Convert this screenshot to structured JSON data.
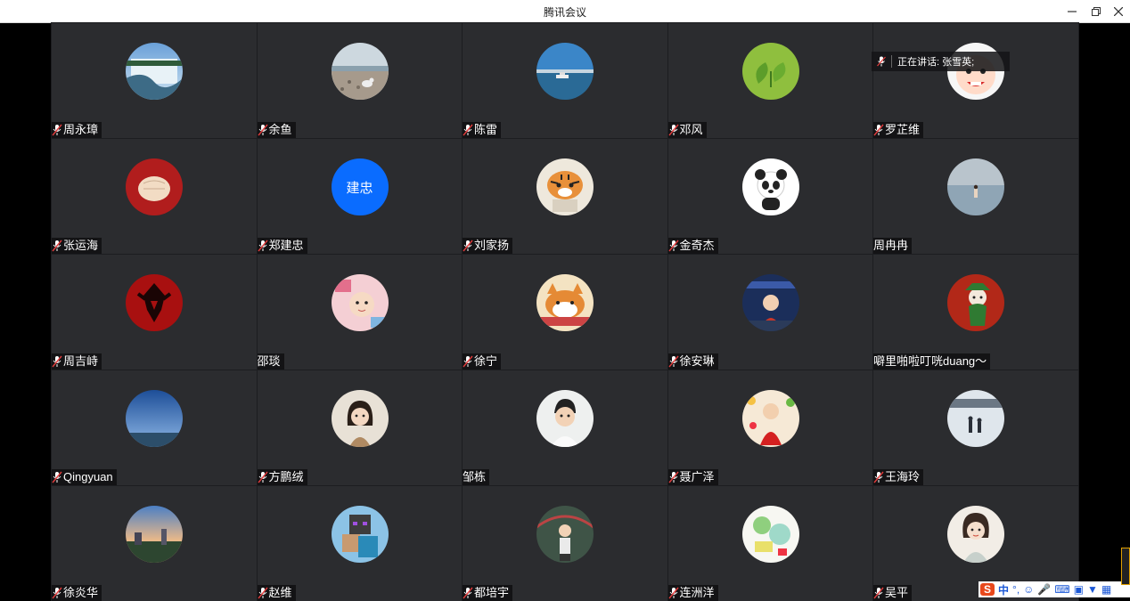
{
  "window": {
    "title": "腾讯会议"
  },
  "speaking": {
    "label": "正在讲话: 张雪英;"
  },
  "ime": {
    "logo": "S",
    "mode": "中",
    "punct": "°,"
  },
  "colors": {
    "tile": "#2b2c2f",
    "divider": "#1c1d20",
    "accent_blue": "#0a6cff"
  },
  "participants": [
    {
      "name": "周永璋",
      "muted": true,
      "avatar": "waterfall"
    },
    {
      "name": "余鱼",
      "muted": true,
      "avatar": "beach-seagull"
    },
    {
      "name": "陈雷",
      "muted": true,
      "avatar": "sea-boat"
    },
    {
      "name": "邓风",
      "muted": true,
      "avatar": "green-plant"
    },
    {
      "name": "罗芷维",
      "muted": true,
      "avatar": "cartoon-face"
    },
    {
      "name": "张运海",
      "muted": true,
      "avatar": "fist"
    },
    {
      "name": "郑建忠",
      "muted": true,
      "avatar": "text",
      "avatar_text": "建忠"
    },
    {
      "name": "刘家扬",
      "muted": true,
      "avatar": "tiger"
    },
    {
      "name": "金奇杰",
      "muted": true,
      "avatar": "panda"
    },
    {
      "name": "周冉冉",
      "muted": false,
      "avatar": "lake-person"
    },
    {
      "name": "周吉峙",
      "muted": true,
      "avatar": "horde-logo"
    },
    {
      "name": "邵琰",
      "muted": false,
      "avatar": "baby"
    },
    {
      "name": "徐宁",
      "muted": true,
      "avatar": "shiba"
    },
    {
      "name": "徐安琳",
      "muted": true,
      "avatar": "girl-night"
    },
    {
      "name": "噼里啪啦叮咣duang～",
      "muted": false,
      "avatar": "red-cartoon"
    },
    {
      "name": "Qingyuan",
      "muted": true,
      "avatar": "sky"
    },
    {
      "name": "方鹏绒",
      "muted": true,
      "avatar": "girl-portrait"
    },
    {
      "name": "邹栋",
      "muted": false,
      "avatar": "boy-portrait"
    },
    {
      "name": "聂广泽",
      "muted": true,
      "avatar": "child-red"
    },
    {
      "name": "王海玲",
      "muted": true,
      "avatar": "snow-people"
    },
    {
      "name": "徐炎华",
      "muted": true,
      "avatar": "sunset-city"
    },
    {
      "name": "赵维",
      "muted": true,
      "avatar": "minecraft"
    },
    {
      "name": "都培宇",
      "muted": true,
      "avatar": "boy-green"
    },
    {
      "name": "连洲洋",
      "muted": true,
      "avatar": "drawing"
    },
    {
      "name": "吴平",
      "muted": true,
      "avatar": "lady-illustration"
    }
  ]
}
